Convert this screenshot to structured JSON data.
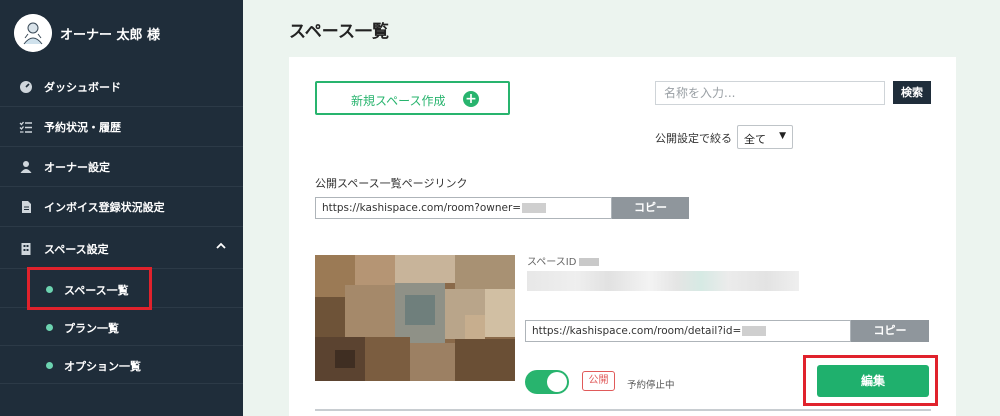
{
  "sidebar": {
    "user_name": "オーナー 太郎 様",
    "items": [
      {
        "label": "ダッシュボード",
        "icon": "dashboard-icon"
      },
      {
        "label": "予約状況・履歴",
        "icon": "list-check-icon"
      },
      {
        "label": "オーナー設定",
        "icon": "user-icon"
      },
      {
        "label": "インボイス登録状況設定",
        "icon": "document-icon"
      },
      {
        "label": "スペース設定",
        "icon": "building-icon",
        "expanded": true
      }
    ],
    "sub_items": [
      {
        "label": "スペース一覧",
        "active": true
      },
      {
        "label": "プラン一覧"
      },
      {
        "label": "オプション一覧"
      }
    ],
    "chevron": "chevron-up-icon"
  },
  "main": {
    "title": "スペース一覧",
    "create_button": "新規スペース作成",
    "search": {
      "placeholder": "名称を入力...",
      "button": "検索"
    },
    "filter": {
      "label": "公開設定で絞る",
      "value": "全て"
    },
    "list_link": {
      "label": "公開スペース一覧ページリンク",
      "url": "https://kashispace.com/room?owner=",
      "copy": "コピー"
    },
    "space": {
      "id_label": "スペースID",
      "detail_url": "https://kashispace.com/room/detail?id=",
      "copy": "コピー",
      "toggle_on": true,
      "status_badge": "公開",
      "stop_label": "予約停止中",
      "edit_button": "編集"
    }
  },
  "colors": {
    "sidebar_bg": "#1f2d3a",
    "accent_green": "#28b46e",
    "highlight_red": "#e0222c",
    "main_bg": "#ecf4ef"
  }
}
